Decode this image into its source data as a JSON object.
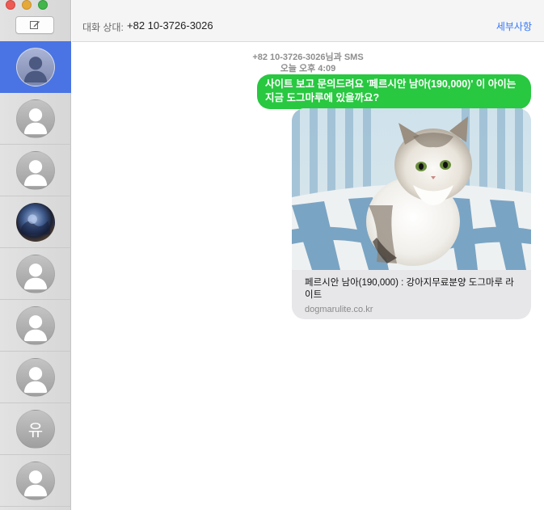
{
  "window": {
    "compose_icon": "compose-icon"
  },
  "header": {
    "to_label": "대화 상대:",
    "to_value": "+82 10-3726-3026",
    "details_label": "세부사항"
  },
  "sidebar": {
    "conversations": [
      {
        "avatar": "person-icon",
        "selected": true
      },
      {
        "avatar": "person-icon",
        "selected": false
      },
      {
        "avatar": "person-icon",
        "selected": false
      },
      {
        "avatar": "photo",
        "selected": false
      },
      {
        "avatar": "person-icon",
        "selected": false
      },
      {
        "avatar": "person-icon",
        "selected": false
      },
      {
        "avatar": "person-icon",
        "selected": false
      },
      {
        "avatar": "initial",
        "initial": "유",
        "selected": false
      },
      {
        "avatar": "person-icon",
        "selected": false
      }
    ]
  },
  "thread": {
    "meta_line1": "+82 10-3726-3026님과 SMS",
    "meta_line2": "오늘 오후 4:09",
    "message_text": "사이트 보고 문의드려요 '페르시안 남아(190,000)' 이 아이는 지금 도그마루에 있을까요?",
    "link_preview": {
      "title": "페르시안 남아(190,000) : 강아지무료분양 도그마루 라이트",
      "domain": "dogmarulite.co.kr"
    }
  },
  "colors": {
    "sent_bubble": "#28c840",
    "selected_row": "#4a74e4",
    "link_accent": "#3478f6"
  }
}
